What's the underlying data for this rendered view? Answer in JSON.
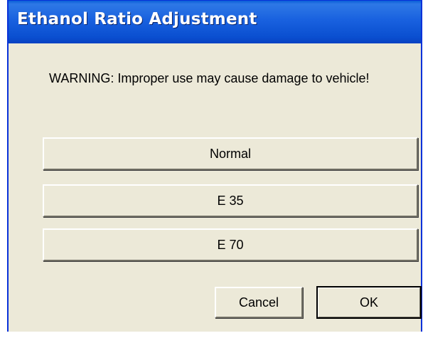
{
  "window": {
    "title": "Ethanol Ratio Adjustment"
  },
  "message": {
    "warning": "WARNING: Improper use may cause damage to vehicle!"
  },
  "options": {
    "normal_label": "Normal",
    "e35_label": "E 35",
    "e70_label": "E 70"
  },
  "actions": {
    "cancel_label": "Cancel",
    "ok_label": "OK"
  },
  "colors": {
    "titlebar": "#0a5fd8",
    "dialog_background": "#ece9d8",
    "title_text": "#ffffff"
  }
}
